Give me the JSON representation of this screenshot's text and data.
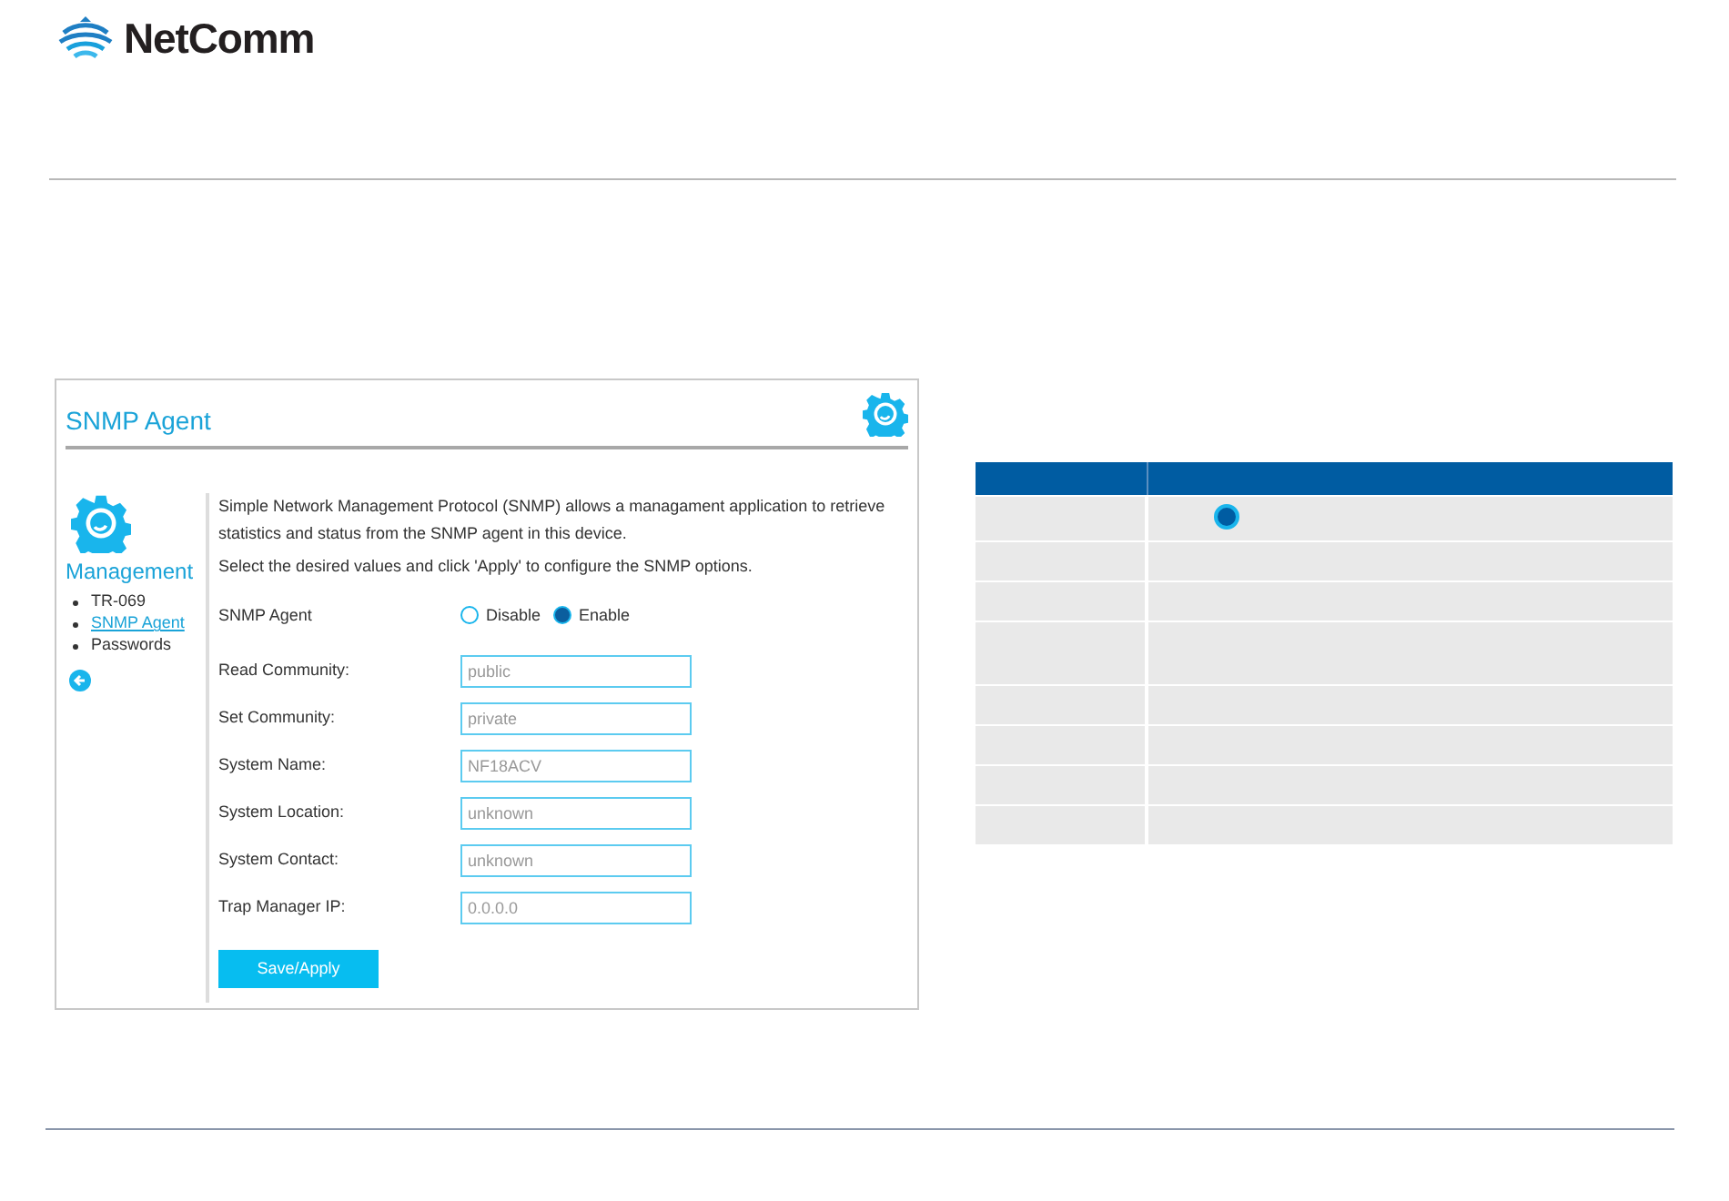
{
  "header": {
    "logo_text": "NetComm"
  },
  "panel": {
    "title": "SNMP Agent",
    "sidebar": {
      "heading": "Management",
      "items": [
        {
          "label": "TR-069",
          "selected": false
        },
        {
          "label": "SNMP Agent",
          "selected": true
        },
        {
          "label": "Passwords",
          "selected": false
        }
      ]
    },
    "description": [
      "Simple Network Management Protocol (SNMP) allows a managament application to retrieve statistics and status from the SNMP agent in this device.",
      "Select the desired values and click 'Apply' to configure the SNMP options."
    ],
    "agent": {
      "label": "SNMP Agent",
      "options": [
        {
          "label": "Disable",
          "selected": false
        },
        {
          "label": "Enable",
          "selected": true
        }
      ]
    },
    "fields": [
      {
        "label": "Read Community:",
        "value": "public"
      },
      {
        "label": "Set Community:",
        "value": "private"
      },
      {
        "label": "System Name:",
        "value": "NF18ACV"
      },
      {
        "label": "System Location:",
        "value": "unknown"
      },
      {
        "label": "System Contact:",
        "value": "unknown"
      },
      {
        "label": "Trap Manager IP:",
        "value": "0.0.0.0"
      }
    ],
    "button": "Save/Apply"
  },
  "table": {
    "rows": [
      {
        "kind": "radio"
      },
      {
        "kind": "plain"
      },
      {
        "kind": "plain"
      },
      {
        "kind": "tall"
      },
      {
        "kind": "plain"
      },
      {
        "kind": "plain"
      },
      {
        "kind": "plain"
      },
      {
        "kind": "plain"
      }
    ]
  }
}
